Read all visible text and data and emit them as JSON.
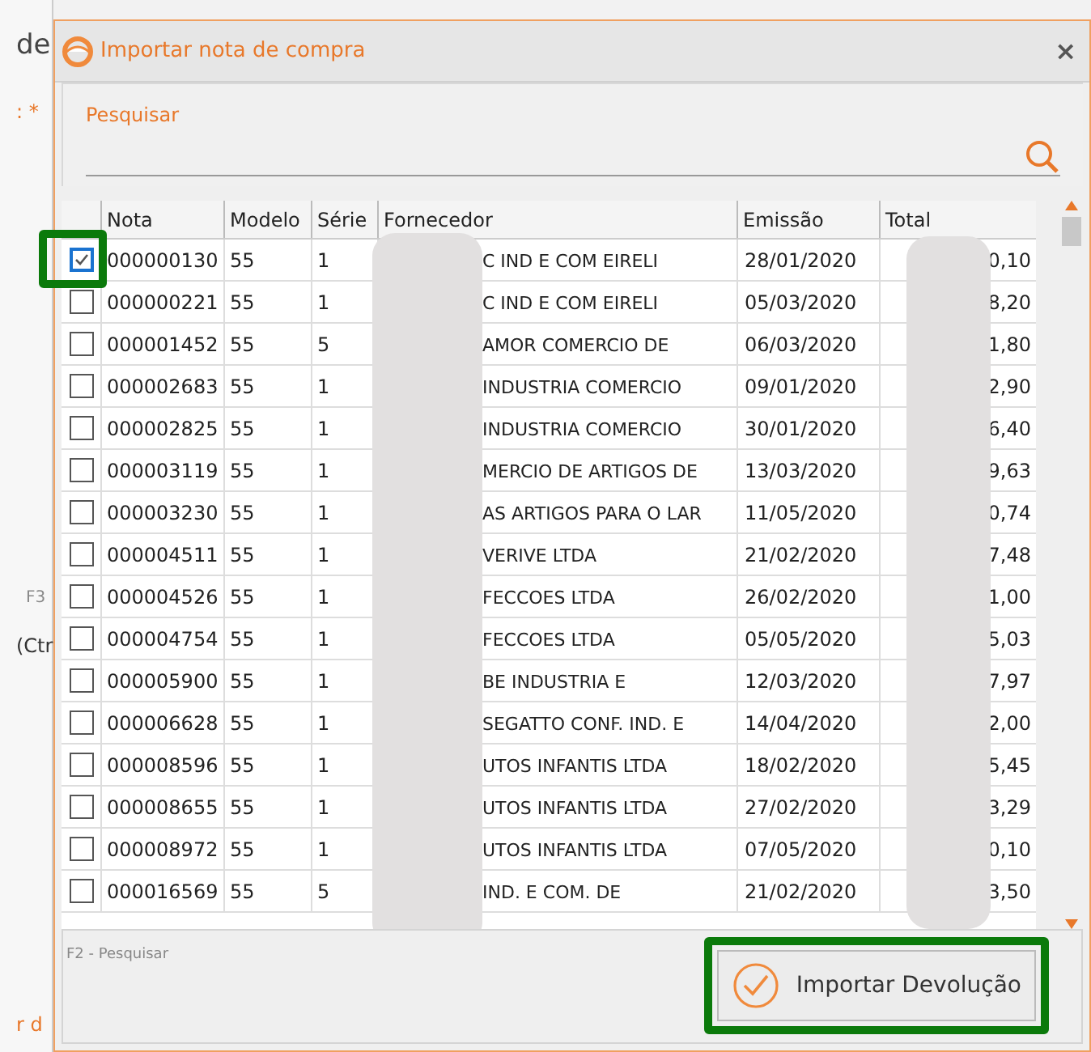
{
  "background_window": {
    "fragments": [
      {
        "kind": "title",
        "text": "de"
      },
      {
        "kind": "label",
        "text": ": *"
      },
      {
        "kind": "key",
        "text": "F3"
      },
      {
        "kind": "plain",
        "text": "(Ctr"
      },
      {
        "kind": "label",
        "text": "r d"
      }
    ]
  },
  "window": {
    "title": "Importar nota de compra",
    "close": "×"
  },
  "search": {
    "label": "Pesquisar"
  },
  "table": {
    "columns": [
      "Nota",
      "Modelo",
      "Série",
      "Fornecedor",
      "Emissão",
      "Total"
    ],
    "rows": [
      {
        "checked": true,
        "nota": "000000130",
        "modelo": "55",
        "serie": "1",
        "fornecedor": "C IND E COM EIRELI",
        "emissao": "28/01/2020",
        "total": "0,10"
      },
      {
        "checked": false,
        "nota": "000000221",
        "modelo": "55",
        "serie": "1",
        "fornecedor": "C IND E COM EIRELI",
        "emissao": "05/03/2020",
        "total": "8,20"
      },
      {
        "checked": false,
        "nota": "000001452",
        "modelo": "55",
        "serie": "5",
        "fornecedor": "AMOR COMERCIO DE",
        "emissao": "06/03/2020",
        "total": "1,80"
      },
      {
        "checked": false,
        "nota": "000002683",
        "modelo": "55",
        "serie": "1",
        "fornecedor": "INDUSTRIA  COMERCIO",
        "emissao": "09/01/2020",
        "total": "2,90"
      },
      {
        "checked": false,
        "nota": "000002825",
        "modelo": "55",
        "serie": "1",
        "fornecedor": "INDUSTRIA  COMERCIO",
        "emissao": "30/01/2020",
        "total": "6,40"
      },
      {
        "checked": false,
        "nota": "000003119",
        "modelo": "55",
        "serie": "1",
        "fornecedor": "MERCIO DE ARTIGOS DE",
        "emissao": "13/03/2020",
        "total": "9,63"
      },
      {
        "checked": false,
        "nota": "000003230",
        "modelo": "55",
        "serie": "1",
        "fornecedor": "AS ARTIGOS PARA O LAR",
        "emissao": "11/05/2020",
        "total": "0,74"
      },
      {
        "checked": false,
        "nota": "000004511",
        "modelo": "55",
        "serie": "1",
        "fornecedor": "VERIVE LTDA",
        "emissao": "21/02/2020",
        "total": "7,48"
      },
      {
        "checked": false,
        "nota": "000004526",
        "modelo": "55",
        "serie": "1",
        "fornecedor": "FECCOES LTDA",
        "emissao": "26/02/2020",
        "total": "1,00"
      },
      {
        "checked": false,
        "nota": "000004754",
        "modelo": "55",
        "serie": "1",
        "fornecedor": "FECCOES LTDA",
        "emissao": "05/05/2020",
        "total": "5,03"
      },
      {
        "checked": false,
        "nota": "000005900",
        "modelo": "55",
        "serie": "1",
        "fornecedor": "BE INDUSTRIA E",
        "emissao": "12/03/2020",
        "total": "7,97"
      },
      {
        "checked": false,
        "nota": "000006628",
        "modelo": "55",
        "serie": "1",
        "fornecedor": "SEGATTO CONF. IND. E",
        "emissao": "14/04/2020",
        "total": "2,00"
      },
      {
        "checked": false,
        "nota": "000008596",
        "modelo": "55",
        "serie": "1",
        "fornecedor": "UTOS INFANTIS LTDA",
        "emissao": "18/02/2020",
        "total": "5,45"
      },
      {
        "checked": false,
        "nota": "000008655",
        "modelo": "55",
        "serie": "1",
        "fornecedor": "UTOS INFANTIS LTDA",
        "emissao": "27/02/2020",
        "total": "3,29"
      },
      {
        "checked": false,
        "nota": "000008972",
        "modelo": "55",
        "serie": "1",
        "fornecedor": "UTOS INFANTIS LTDA",
        "emissao": "07/05/2020",
        "total": "0,10"
      },
      {
        "checked": false,
        "nota": "000016569",
        "modelo": "55",
        "serie": "5",
        "fornecedor": "IND. E COM. DE",
        "emissao": "21/02/2020",
        "total": "3,50"
      }
    ]
  },
  "footer": {
    "hint": "F2 - Pesquisar"
  },
  "buttons": [
    {
      "label": "Importar Devolução",
      "highlighted": true
    }
  ]
}
